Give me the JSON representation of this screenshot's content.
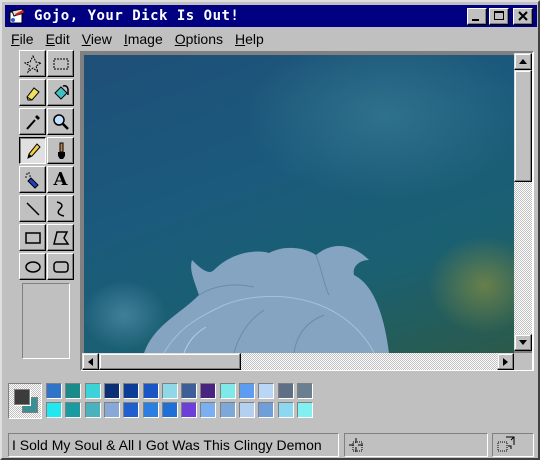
{
  "window": {
    "title": "Gojo, Your Dick Is Out!",
    "icon": "paint-app-icon",
    "controls": [
      "minimize-icon",
      "maximize-icon",
      "close-icon"
    ]
  },
  "menu": {
    "items": [
      {
        "label": "File",
        "accel": "F",
        "rest": "ile"
      },
      {
        "label": "Edit",
        "accel": "E",
        "rest": "dit"
      },
      {
        "label": "View",
        "accel": "V",
        "rest": "iew"
      },
      {
        "label": "Image",
        "accel": "I",
        "rest": "mage"
      },
      {
        "label": "Options",
        "accel": "O",
        "rest": "ptions"
      },
      {
        "label": "Help",
        "accel": "H",
        "rest": "elp"
      }
    ]
  },
  "toolbox": {
    "tools": [
      {
        "name": "free-form-select",
        "icon": "free-select-icon"
      },
      {
        "name": "select",
        "icon": "rect-select-icon"
      },
      {
        "name": "eraser",
        "icon": "eraser-icon"
      },
      {
        "name": "fill",
        "icon": "fill-bucket-icon"
      },
      {
        "name": "pick-color",
        "icon": "eyedropper-icon"
      },
      {
        "name": "magnifier",
        "icon": "magnifier-icon"
      },
      {
        "name": "pencil",
        "icon": "pencil-icon",
        "active": true
      },
      {
        "name": "brush",
        "icon": "brush-icon"
      },
      {
        "name": "airbrush",
        "icon": "airbrush-icon"
      },
      {
        "name": "text",
        "icon": "text-icon",
        "glyph": "A"
      },
      {
        "name": "line",
        "icon": "line-icon"
      },
      {
        "name": "curve",
        "icon": "curve-icon"
      },
      {
        "name": "rectangle",
        "icon": "rectangle-icon"
      },
      {
        "name": "polygon",
        "icon": "polygon-icon"
      },
      {
        "name": "ellipse",
        "icon": "ellipse-icon"
      },
      {
        "name": "rounded-rectangle",
        "icon": "rounded-rect-icon"
      }
    ]
  },
  "colors": {
    "foreground": "#3c3c3c",
    "background": "#3a8f95",
    "palette_top": [
      "#2f74c8",
      "#1a8a8a",
      "#3bd3d8",
      "#0d2f75",
      "#0c3d96",
      "#1a54c5",
      "#8fd8e8",
      "#3d5e97",
      "#48257f",
      "#7fe8e8",
      "#5d9cf0",
      "#b9d6f6",
      "#5e6f86",
      "#6a7f8f"
    ],
    "palette_bottom": [
      "#20e8f0",
      "#1b9aa0",
      "#4ab2bd",
      "#88a8d8",
      "#1f5fd0",
      "#2b7fe0",
      "#1e6fd6",
      "#6e3ed8",
      "#7ab0f2",
      "#7da8d8",
      "#b4d0f0",
      "#6f9fd8",
      "#8cd8f0",
      "#80f0f0"
    ]
  },
  "status": {
    "text": "I Sold My Soul & All I Got Was This Clingy Demon"
  }
}
